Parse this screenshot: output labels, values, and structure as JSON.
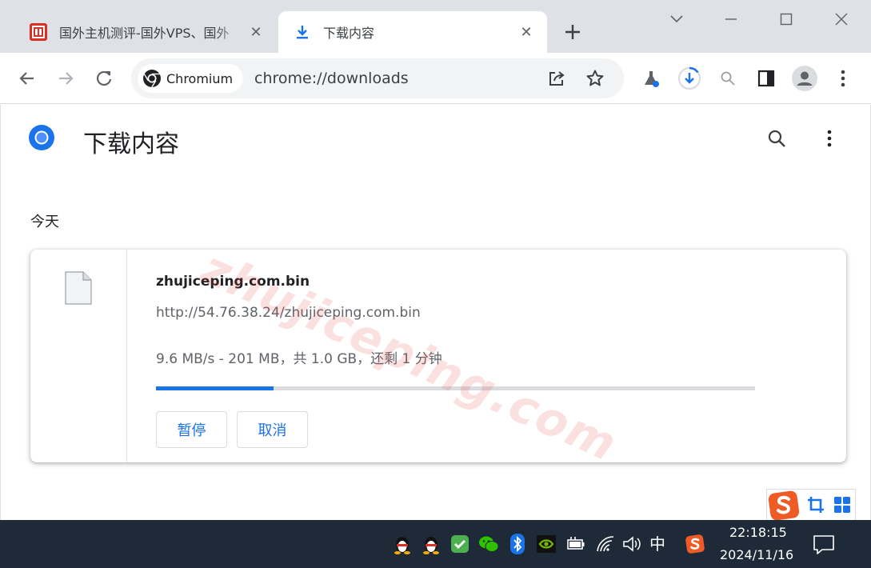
{
  "browser": {
    "tabs": [
      {
        "title": "国外主机测评-国外VPS、国外",
        "active": false
      },
      {
        "title": "下载内容",
        "active": true
      }
    ],
    "toolbar": {
      "site_chip": "Chromium",
      "url": "chrome://downloads"
    }
  },
  "page": {
    "title": "下载内容",
    "date_group": "今天",
    "download": {
      "file_name": "zhujiceping.com.bin",
      "url": "http://54.76.38.24/zhujiceping.com.bin",
      "status": "9.6 MB/s - 201 MB，共 1.0 GB，还剩 1 分钟",
      "progress_percent": 19.6,
      "pause_label": "暂停",
      "cancel_label": "取消"
    },
    "watermark": "zhujiceping.com"
  },
  "taskbar": {
    "ime_mode": "中",
    "time": "22:18:15",
    "date": "2024/11/16"
  },
  "colors": {
    "accent": "#1a73e8",
    "taskbar": "#1e2a38",
    "tabstrip": "#dee1e6",
    "sogou": "#ef5b25"
  }
}
